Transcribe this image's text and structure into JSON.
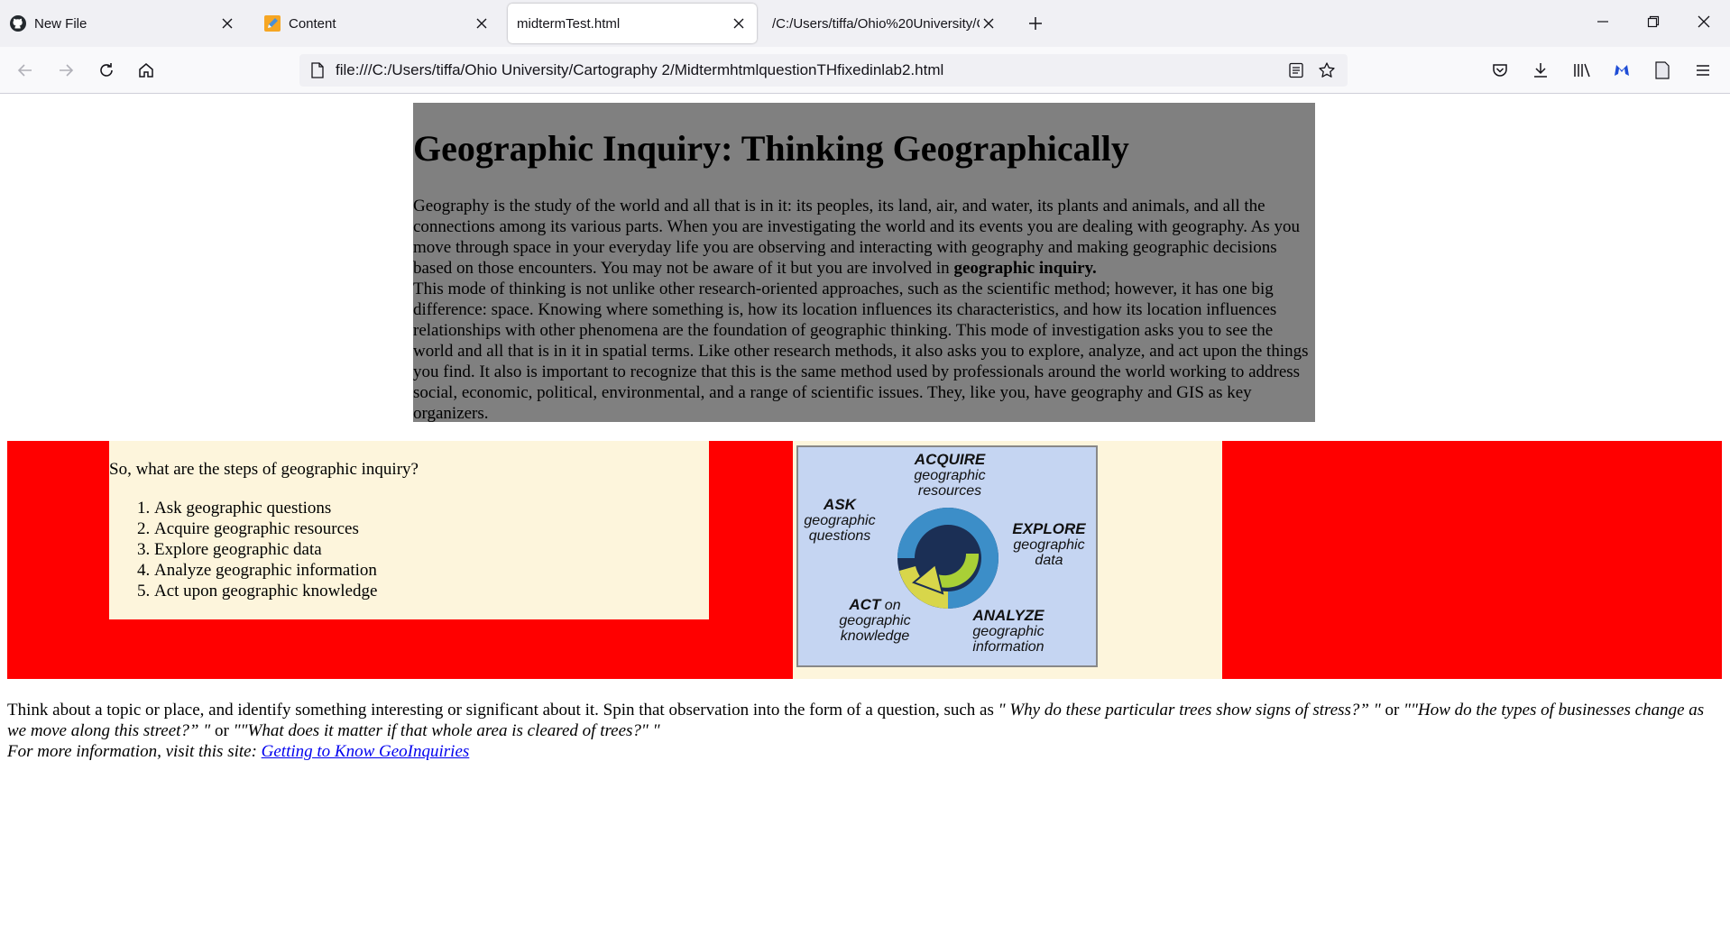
{
  "browser": {
    "tabs": [
      {
        "title": "New File",
        "icon": "github-icon",
        "active": false
      },
      {
        "title": "Content",
        "icon": "pencil-icon",
        "active": false
      },
      {
        "title": "midtermTest.html",
        "icon": "",
        "active": true
      },
      {
        "title": "/C:/Users/tiffa/Ohio%20University/C",
        "icon": "",
        "active": false
      }
    ],
    "url": "file:///C:/Users/tiffa/Ohio University/Cartography 2/MidtermhtmlquestionTHfixedinlab2.html"
  },
  "page": {
    "title": "Geographic Inquiry: Thinking Geographically",
    "para1": "Geography is the study of the world and all that is in it: its peoples, its land, air, and water, its plants and animals, and all the connections among its various parts. When you are investigating the world and its events you are dealing with geography. As you move through space in your everyday life you are observing and interacting with geography and making geographic decisions based on those encounters. You may not be aware of it but you are involved in ",
    "para1_bold": "geographic inquiry.",
    "para2": "This mode of thinking is not unlike other research-oriented approaches, such as the scientific method; however, it has one big difference: space. Knowing where something is, how its location influences its characteristics, and how its location influences relationships with other phenomena are the foundation of geographic thinking. This mode of investigation asks you to see the world and all that is in it in spatial terms. Like other research methods, it also asks you to explore, analyze, and act upon the things you find. It also is important to recognize that this is the same method used by professionals around the world working to address social, economic, political, environmental, and a range of scientific issues. They, like you, have geography and GIS as key organizers.",
    "steps_question": "So, what are the steps of geographic inquiry?",
    "steps": [
      "Ask geographic questions",
      "Acquire geographic resources",
      "Explore geographic data",
      "Analyze geographic information",
      "Act upon geographic knowledge"
    ],
    "diagram": {
      "acquire_head": "ACQUIRE",
      "acquire_sub": "geographic resources",
      "ask_head": "ASK",
      "ask_sub": "geographic questions",
      "explore_head": "EXPLORE",
      "explore_sub": "geographic data",
      "analyze_head": "ANALYZE",
      "analyze_sub": "geographic information",
      "act_head": "ACT",
      "act_on": "on",
      "act_sub": "geographic knowledge"
    },
    "bottom_intro": "Think about a topic or place, and identify something interesting or significant about it. Spin that observation into the form of a question, such as ",
    "bottom_q1": "\" Why do these particular trees show signs of stress?” \"",
    "bottom_or1": " or ",
    "bottom_q2": "\"\"How do the types of businesses change as we move along this street?” \"",
    "bottom_or2": " or ",
    "bottom_q3": "\"\"What does it matter if that whole area is cleared of trees?\" \"",
    "bottom_more": "For more information, visit this site: ",
    "bottom_link": "Getting to Know GeoInquiries"
  }
}
